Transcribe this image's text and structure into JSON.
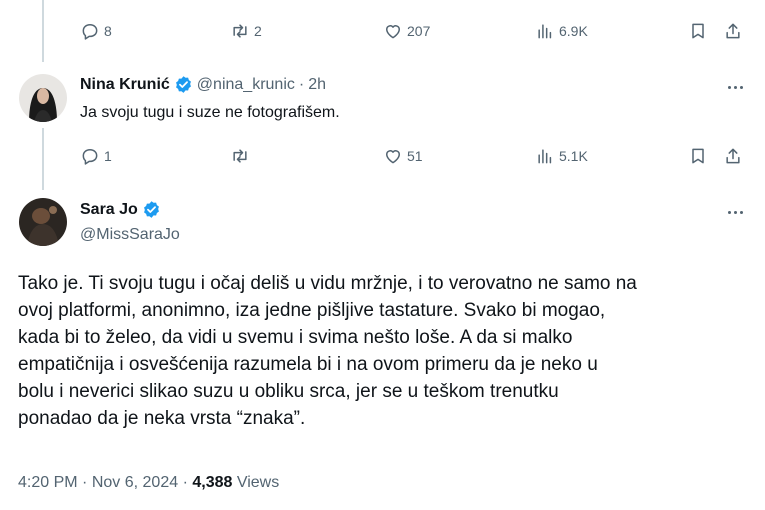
{
  "prev_tweet_actions": {
    "replies": "8",
    "retweets": "2",
    "likes": "207",
    "views": "6.9K"
  },
  "reply_tweet": {
    "name": "Nina Krunić",
    "handle": "@nina_krunic",
    "separator": "·",
    "time": "2h",
    "text": "Ja svoju tugu i suze ne fotografišem.",
    "actions": {
      "replies": "1",
      "retweets": "",
      "likes": "51",
      "views": "5.1K"
    }
  },
  "main_tweet": {
    "name": "Sara Jo",
    "handle": "@MissSaraJo",
    "text_lines": [
      "Tako je. Ti svoju tugu i očaj deliš u vidu mržnje, i to verovatno ne samo na",
      "ovoj platformi, anonimno, iza jedne pišljive tastature. Svako bi mogao,",
      "kada bi to želeo, da vidi u svemu i svima nešto loše. A da si malko",
      "empatičnija i osvešćenija razumela bi i na ovom primeru da je neko u",
      "bolu i neverici slikao suzu u obliku srca, jer se u teškom trenutku",
      "ponadao da je neka vrsta “znaka”."
    ],
    "time": "4:20 PM",
    "separator": "·",
    "date": "Nov 6, 2024",
    "separator2": "·",
    "views_count": "4,388",
    "views_label": "Views"
  },
  "icons": {
    "reply": "reply-icon",
    "retweet": "retweet-icon",
    "like": "heart-icon",
    "views": "views-icon",
    "bookmark": "bookmark-icon",
    "share": "share-icon",
    "verified": "verified-badge-icon",
    "more": "more-icon"
  },
  "colors": {
    "verified": "#1d9bf0",
    "secondary_text": "#536471",
    "primary_text": "#0f1419",
    "thread_line": "#cfd9de"
  }
}
